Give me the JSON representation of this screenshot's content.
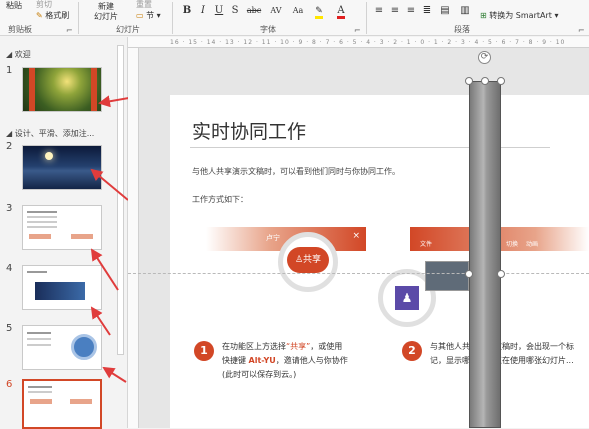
{
  "ribbon": {
    "paste_label": "粘贴",
    "cut_label": "剪切",
    "format_painter_label": "格式刷",
    "clipboard_group": "剪贴板",
    "new_slide_label": "新建\n幻灯片",
    "reset_label": "重置",
    "section_label": "节",
    "slides_group": "幻灯片",
    "font_group": "字体",
    "bold": "B",
    "italic": "I",
    "underline": "U",
    "strike": "S",
    "shadow": "abc",
    "spacing": "AV",
    "case": "Aa",
    "paragraph_group": "段落",
    "smartart_label": "转换为 SmartArt"
  },
  "thumbnails": {
    "section1": "欢迎",
    "section2": "设计、平滑、添加注...",
    "slides": [
      {
        "num": "1"
      },
      {
        "num": "2"
      },
      {
        "num": "3"
      },
      {
        "num": "4"
      },
      {
        "num": "5"
      },
      {
        "num": "6"
      }
    ]
  },
  "ruler": {
    "ticks": "16 · 15 · 14 · 13 · 12 · 11 · 10 · 9 · 8 · 7 · 6 · 5 · 4 · 3 · 2 · 1 · 0 · 1 · 2 · 3 · 4 · 5 · 6 · 7 · 8 · 9 · 10"
  },
  "slide": {
    "title": "实时协同工作",
    "intro": "与他人共享演示文稿时，可以看到他们同时与你协同工作。",
    "how_label": "工作方式如下：",
    "bar1_user": "卢宁",
    "share_button": "共享",
    "bar2_file": "文件",
    "bar2_design": "设计",
    "bar2_transition": "切换",
    "bar2_animation": "动画",
    "step1_num": "1",
    "step1_line1_a": "在功能区上方选择",
    "step1_line1_b": "“共享”",
    "step1_line1_c": "，或使用",
    "step1_line2_a": "快捷键",
    "step1_line2_b": "Alt-YU",
    "step1_line2_c": "，邀请他人与你协作",
    "step1_line3": "(此时可以保存到云。)",
    "step2_num": "2",
    "step2_line1": "与其他人共享演示文稿时，会出现一个标",
    "step2_line2": "记，显示哪位用户正在使用哪张幻灯片..."
  },
  "colors": {
    "accent": "#d24726",
    "arrow": "#e03c3c",
    "ribbon_bg": "#f7f7f7"
  }
}
